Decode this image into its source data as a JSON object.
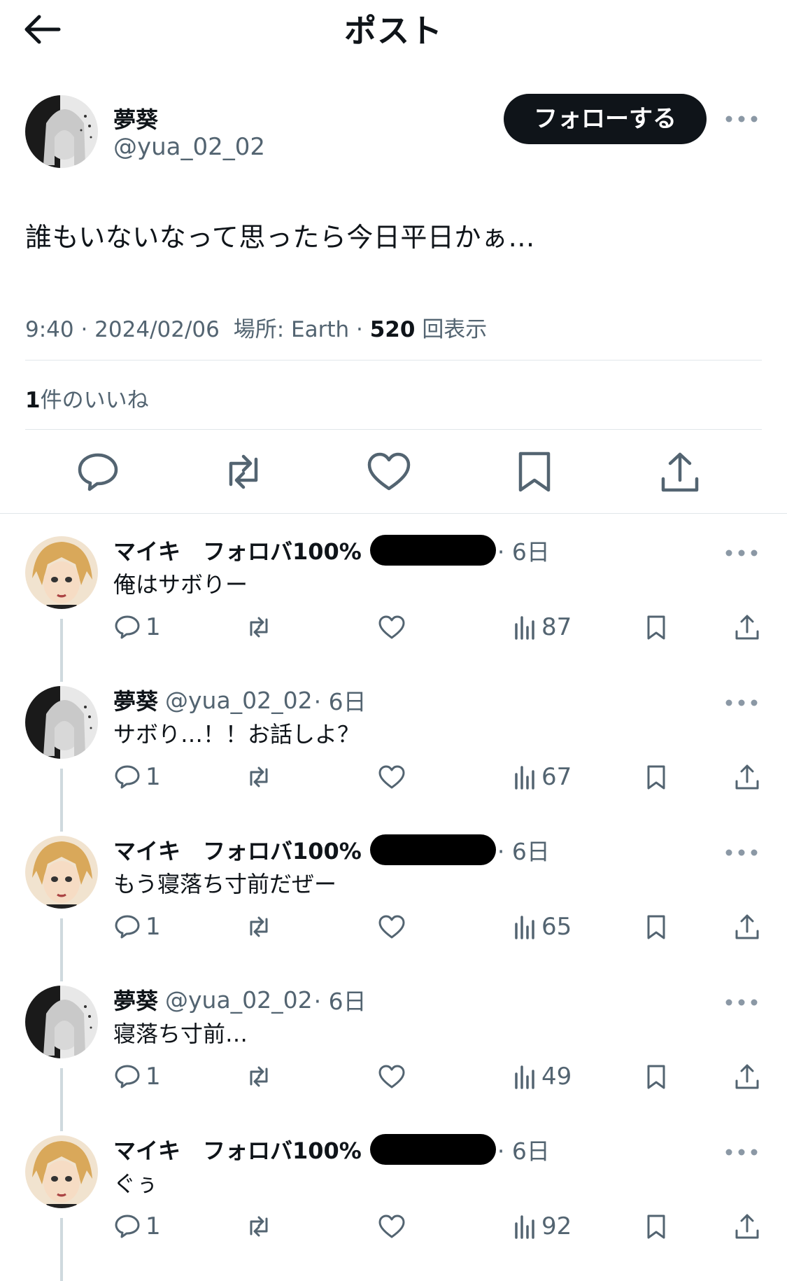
{
  "header": {
    "title": "ポスト"
  },
  "post": {
    "author_name": "夢葵",
    "author_handle": "@yua_02_02",
    "follow_label": "フォローする",
    "text": "誰もいないなって思ったら今日平日かぁ…",
    "time": "9:40 · 2024/02/06",
    "place": "場所: Earth",
    "views_count": "520",
    "views_label": "回表示",
    "likes_count": "1",
    "likes_label": "件のいいね"
  },
  "replies": [
    {
      "name": "マイキ　フォロバ100%",
      "handle": "",
      "time": "· 6日",
      "text": "俺はサボりー",
      "reply_count": "1",
      "views": "87",
      "avatar": "mikey",
      "censored": true
    },
    {
      "name": "夢葵",
      "handle": "@yua_02_02",
      "time": "· 6日",
      "text": "サボり…！！お話しよ？",
      "reply_count": "1",
      "views": "67",
      "avatar": "yua",
      "censored": false
    },
    {
      "name": "マイキ　フォロバ100%",
      "handle": "",
      "time": "· 6日",
      "text": "もう寝落ち寸前だぜー",
      "reply_count": "1",
      "views": "65",
      "avatar": "mikey",
      "censored": true
    },
    {
      "name": "夢葵",
      "handle": "@yua_02_02",
      "time": "· 6日",
      "text": "寝落ち寸前…",
      "reply_count": "1",
      "views": "49",
      "avatar": "yua",
      "censored": false
    },
    {
      "name": "マイキ　フォロバ100%",
      "handle": "",
      "time": "· 6日",
      "text": "ぐぅ",
      "reply_count": "1",
      "views": "92",
      "avatar": "mikey",
      "censored": true
    }
  ],
  "icons": [
    "back-arrow-icon",
    "more-icon",
    "reply-icon",
    "retweet-icon",
    "like-icon",
    "bookmark-icon",
    "share-icon",
    "views-icon"
  ],
  "colors": {
    "text": "#0f1419",
    "secondary": "#536471",
    "divider": "#e1e6ea",
    "follow_bg": "#0f1419"
  }
}
